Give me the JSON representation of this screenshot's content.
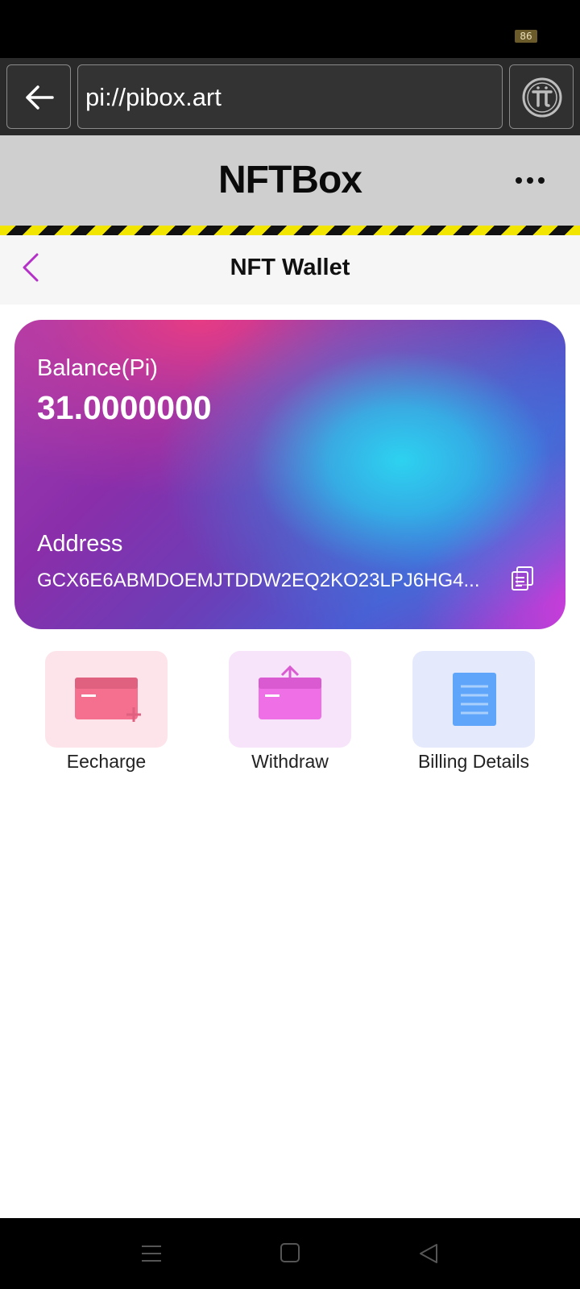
{
  "status_bar": {
    "battery": "86"
  },
  "browser": {
    "url": "pi://pibox.art"
  },
  "app": {
    "title": "NFTBox"
  },
  "page": {
    "title": "NFT Wallet"
  },
  "wallet": {
    "balance_label": "Balance(Pi)",
    "balance_value": "31.0000000",
    "address_label": "Address",
    "address_value": "GCX6E6ABMDOEMJTDDW2EQ2KO23LPJ6HG4..."
  },
  "actions": [
    {
      "label": "Eecharge",
      "icon": "recharge-card-icon",
      "tile_color": "#fde4ea",
      "icon_color": "#f56f8f"
    },
    {
      "label": "Withdraw",
      "icon": "withdraw-card-icon",
      "tile_color": "#f7e3fa",
      "icon_color": "#ee6fe6"
    },
    {
      "label": "Billing Details",
      "icon": "billing-document-icon",
      "tile_color": "#e5e9fc",
      "icon_color": "#5fa6fb"
    }
  ],
  "colors": {
    "accent": "#b430c8",
    "header_bg": "#cfcfcf",
    "hazard_yellow": "#f2e600"
  },
  "nav": {
    "icons": [
      "menu-icon",
      "home-icon",
      "back-triangle-icon"
    ]
  }
}
